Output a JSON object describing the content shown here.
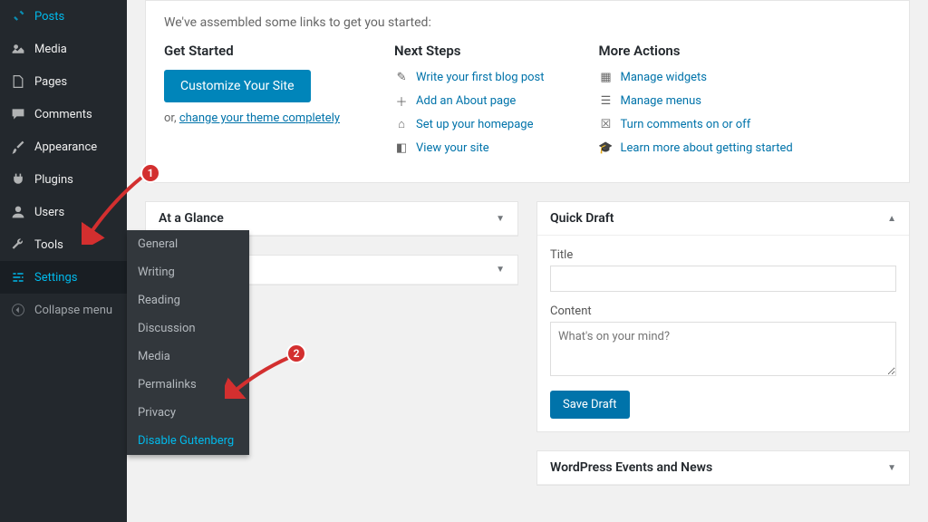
{
  "sidebar": {
    "items": [
      {
        "label": "Posts"
      },
      {
        "label": "Media"
      },
      {
        "label": "Pages"
      },
      {
        "label": "Comments"
      },
      {
        "label": "Appearance"
      },
      {
        "label": "Plugins"
      },
      {
        "label": "Users"
      },
      {
        "label": "Tools"
      },
      {
        "label": "Settings"
      }
    ],
    "collapse": "Collapse menu"
  },
  "submenu": {
    "items": [
      {
        "label": "General"
      },
      {
        "label": "Writing"
      },
      {
        "label": "Reading"
      },
      {
        "label": "Discussion"
      },
      {
        "label": "Media"
      },
      {
        "label": "Permalinks"
      },
      {
        "label": "Privacy"
      },
      {
        "label": "Disable Gutenberg"
      }
    ]
  },
  "welcome": {
    "intro": "We've assembled some links to get you started:",
    "getstarted": {
      "heading": "Get Started",
      "button": "Customize Your Site",
      "or": "or,",
      "link": "change your theme completely"
    },
    "nextsteps": {
      "heading": "Next Steps",
      "links": [
        "Write your first blog post",
        "Add an About page",
        "Set up your homepage",
        "View your site"
      ]
    },
    "moreactions": {
      "heading": "More Actions",
      "links": [
        "Manage widgets",
        "Manage menus",
        "Turn comments on or off",
        "Learn more about getting started"
      ]
    }
  },
  "glance": {
    "title": "At a Glance"
  },
  "draft": {
    "title": "Quick Draft",
    "title_label": "Title",
    "content_label": "Content",
    "placeholder": "What's on your mind?",
    "save": "Save Draft"
  },
  "events": {
    "title": "WordPress Events and News"
  },
  "badges": {
    "one": "1",
    "two": "2"
  }
}
